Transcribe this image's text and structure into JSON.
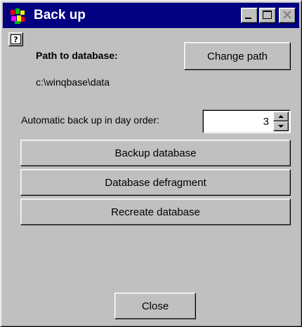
{
  "window": {
    "title": "Back up",
    "icon": "winqbase-app-icon",
    "controls": {
      "minimize": "minimize-icon",
      "maximize": "maximize-icon",
      "close": "close-icon"
    }
  },
  "help_icon": "help-icon",
  "path": {
    "label": "Path to database:",
    "value": "c:\\winqbase\\data",
    "change_button": "Change path"
  },
  "auto_backup": {
    "label": "Automatic back up in day order:",
    "value": "3"
  },
  "actions": {
    "backup": "Backup database",
    "defragment": "Database defragment",
    "recreate": "Recreate database"
  },
  "close_button": "Close",
  "colors": {
    "titlebar": "#000080",
    "face": "#c0c0c0"
  }
}
